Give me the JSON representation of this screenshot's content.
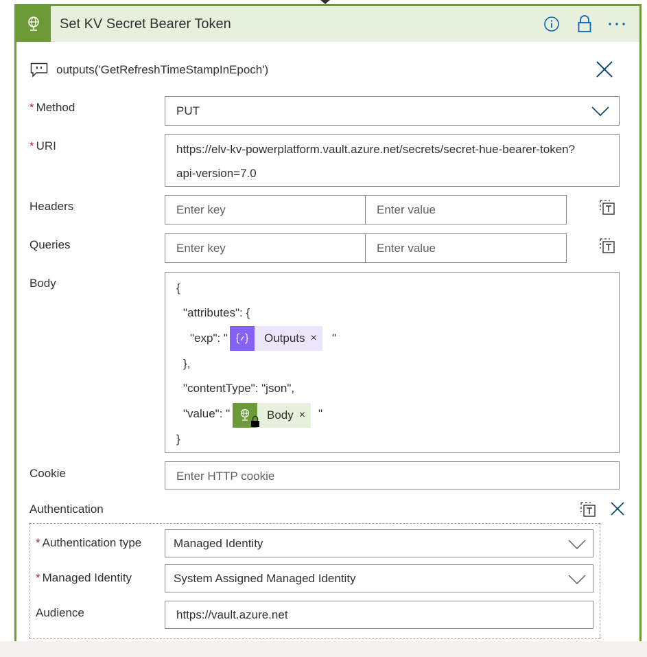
{
  "header": {
    "title": "Set KV Secret Bearer Token",
    "icons": [
      "globe-icon",
      "info-icon",
      "lock-icon",
      "more-icon"
    ]
  },
  "comment": {
    "text": "outputs('GetRefreshTimeStampInEpoch')"
  },
  "form": {
    "method": {
      "label": "Method",
      "required": "*",
      "value": "PUT"
    },
    "uri": {
      "label": "URI",
      "required": "*",
      "line1": "https://elv-kv-powerplatform.vault.azure.net/secrets/secret-hue-bearer-token?",
      "line2": "api-version=7.0"
    },
    "headers": {
      "label": "Headers",
      "key_placeholder": "Enter key",
      "value_placeholder": "Enter value"
    },
    "queries": {
      "label": "Queries",
      "key_placeholder": "Enter key",
      "value_placeholder": "Enter value"
    },
    "body": {
      "label": "Body",
      "lines": {
        "open": "{",
        "attributes": "\"attributes\": {",
        "exp_prefix": "\"exp\": \"",
        "exp_suffix": "\"",
        "close_attr": "},",
        "content_type": "\"contentType\": \"json\",",
        "value_prefix": "\"value\": \"",
        "value_suffix": "\"",
        "close": "}"
      },
      "tokens": {
        "outputs": {
          "label": "Outputs",
          "remove": "×"
        },
        "body": {
          "label": "Body",
          "remove": "×"
        }
      }
    },
    "cookie": {
      "label": "Cookie",
      "placeholder": "Enter HTTP cookie"
    },
    "authentication": {
      "label": "Authentication",
      "type": {
        "label": "Authentication type",
        "required": "*",
        "value": "Managed Identity"
      },
      "identity": {
        "label": "Managed Identity",
        "required": "*",
        "value": "System Assigned Managed Identity"
      },
      "audience": {
        "label": "Audience",
        "value": "https://vault.azure.net"
      }
    }
  },
  "colors": {
    "header_bg": "#e7efdd",
    "accent_green": "#6b9a36",
    "expression_purple": "#8661f5",
    "required_red": "#a4262c"
  }
}
